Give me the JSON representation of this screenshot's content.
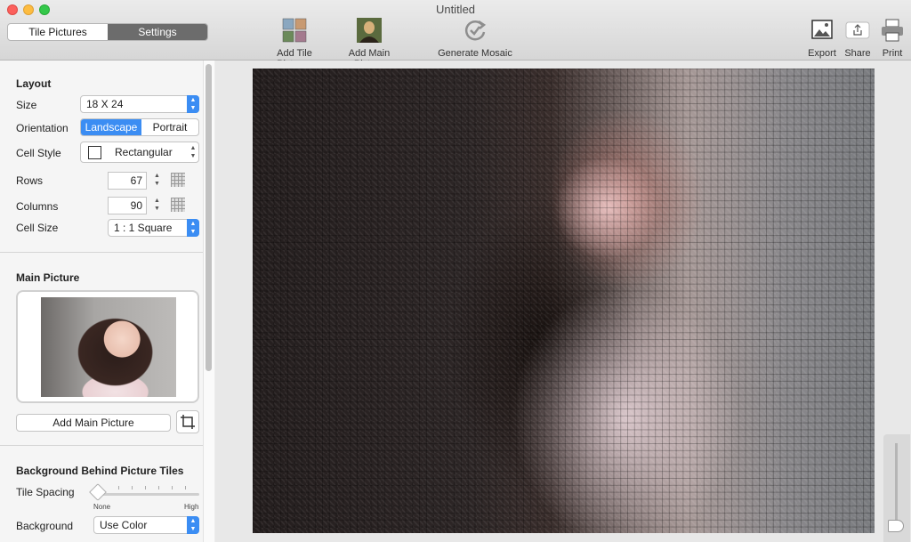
{
  "window": {
    "title": "Untitled"
  },
  "mode_tabs": [
    {
      "label": "Tile Pictures",
      "active": false
    },
    {
      "label": "Settings",
      "active": true
    }
  ],
  "toolbar": {
    "add_tile_pictures": "Add Tile Pictures",
    "add_main_picture": "Add Main Picture",
    "generate_mosaic": "Generate Mosaic",
    "export": "Export",
    "share": "Share",
    "print": "Print"
  },
  "layout": {
    "heading": "Layout",
    "size_label": "Size",
    "size_value": "18 X 24",
    "orientation_label": "Orientation",
    "orientation_options": [
      "Landscape",
      "Portrait"
    ],
    "orientation_selected": "Landscape",
    "cell_style_label": "Cell Style",
    "cell_style_value": "Rectangular",
    "rows_label": "Rows",
    "rows_value": "67",
    "columns_label": "Columns",
    "columns_value": "90",
    "cell_size_label": "Cell Size",
    "cell_size_value": "1 : 1 Square"
  },
  "main_picture": {
    "heading": "Main Picture",
    "add_button": "Add Main Picture"
  },
  "background": {
    "heading": "Background Behind Picture Tiles",
    "tile_spacing_label": "Tile Spacing",
    "slider_min_label": "None",
    "slider_max_label": "High",
    "tile_spacing_level": 0,
    "background_label": "Background",
    "background_value": "Use Color"
  },
  "colors": {
    "accent": "#3b8df3",
    "close": "#fc605c",
    "minimize": "#fdbc40",
    "maximize": "#34c84a"
  },
  "zoom_level": 0
}
